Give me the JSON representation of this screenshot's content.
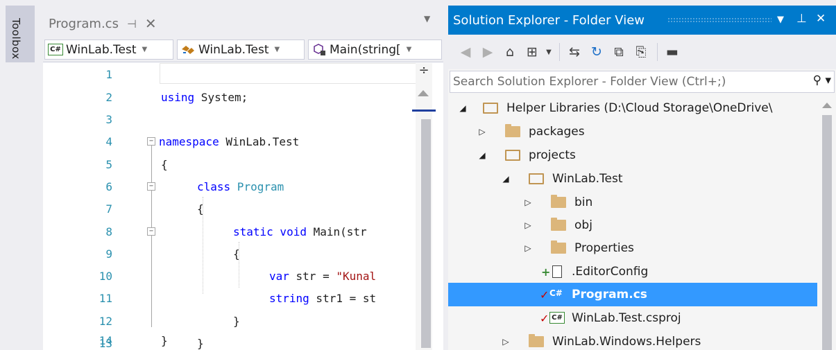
{
  "toolbox": {
    "label": "Toolbox"
  },
  "editor": {
    "tab": {
      "title": "Program.cs",
      "pin_glyph": "⊣",
      "close_glyph": "✕"
    },
    "tab_dropdown_glyph": "▼",
    "navbar": {
      "project": "WinLab.Test",
      "type_scope": "WinLab.Test",
      "member": "Main(string[",
      "cs_badge": "C#"
    },
    "split_glyph": "÷",
    "lines": [
      {
        "num": "1"
      },
      {
        "num": "2"
      },
      {
        "num": "3"
      },
      {
        "num": "4"
      },
      {
        "num": "5"
      },
      {
        "num": "6"
      },
      {
        "num": "7"
      },
      {
        "num": "8"
      },
      {
        "num": "9"
      },
      {
        "num": "10"
      },
      {
        "num": "11"
      },
      {
        "num": "12"
      },
      {
        "num": "13"
      },
      {
        "num": "14"
      }
    ],
    "code": {
      "l2_kw": "using",
      "l2_rest": " System;",
      "l4_kw": "namespace",
      "l4_rest": " WinLab.Test",
      "l5": "{",
      "l6_kw": "class",
      "l6_type": " Program",
      "l7": "{",
      "l8_kw": "static void",
      "l8_rest": " Main(str",
      "l9": "{",
      "l10_kw": "var",
      "l10_rest": " str = ",
      "l10_str": "\"Kunal",
      "l11_kw": "string",
      "l11_rest": " str1 = st",
      "l12": "}",
      "l13": "}",
      "l14": "}"
    }
  },
  "solution_explorer": {
    "title": "Solution Explorer - Folder View",
    "title_buttons": {
      "dropdown": "▼",
      "pin": "⊥",
      "close": "✕"
    },
    "search_placeholder": "Search Solution Explorer - Folder View (Ctrl+;)",
    "search_glyph": "⚲",
    "tree": {
      "root": "Helper Libraries (D:\\Cloud Storage\\OneDrive\\",
      "packages": "packages",
      "projects": "projects",
      "winlab_test": "WinLab.Test",
      "bin": "bin",
      "obj": "obj",
      "properties": "Properties",
      "editorconfig": ".EditorConfig",
      "program_cs": "Program.cs",
      "csproj": "WinLab.Test.csproj",
      "windows_helpers": "WinLab.Windows.Helpers"
    },
    "badges": {
      "cs": "C#",
      "plus": "+",
      "check": "✓"
    }
  }
}
